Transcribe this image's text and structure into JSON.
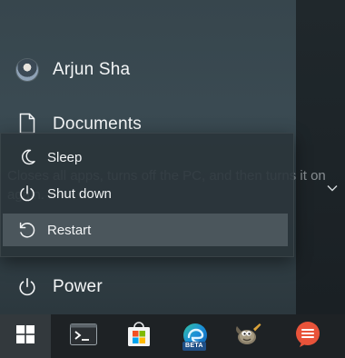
{
  "start_menu": {
    "user": {
      "name": "Arjun Sha",
      "icon": "user-avatar"
    },
    "documents": {
      "label": "Documents",
      "icon": "document-icon"
    },
    "power": {
      "label": "Power",
      "icon": "power-icon"
    },
    "expand_icon": "chevron-down-icon"
  },
  "tooltip": {
    "text": "Closes all apps, turns off the PC, and then turns it on again."
  },
  "power_menu": {
    "items": [
      {
        "label": "Sleep",
        "icon": "moon-icon",
        "selected": false
      },
      {
        "label": "Shut down",
        "icon": "power-icon",
        "selected": false
      },
      {
        "label": "Restart",
        "icon": "restart-icon",
        "selected": true
      }
    ]
  },
  "taskbar": {
    "items": [
      {
        "name": "start",
        "icon": "windows-logo-icon",
        "active": true
      },
      {
        "name": "terminal",
        "icon": "terminal-icon"
      },
      {
        "name": "microsoft-store",
        "icon": "store-icon"
      },
      {
        "name": "edge-beta",
        "icon": "edge-beta-icon",
        "badge": "BETA"
      },
      {
        "name": "gimp",
        "icon": "gimp-icon"
      },
      {
        "name": "chat-app",
        "icon": "chat-app-icon"
      }
    ]
  },
  "colors": {
    "taskbar_bg": "#1e2225",
    "menu_bg": "#2a343a",
    "selected_bg": "#4b565c",
    "store_red": "#f25022",
    "store_green": "#7fba00",
    "store_blue": "#00a4ef",
    "store_yellow": "#ffb900",
    "edge_blue": "#1b8fd8",
    "chat_orange": "#e8533a"
  }
}
